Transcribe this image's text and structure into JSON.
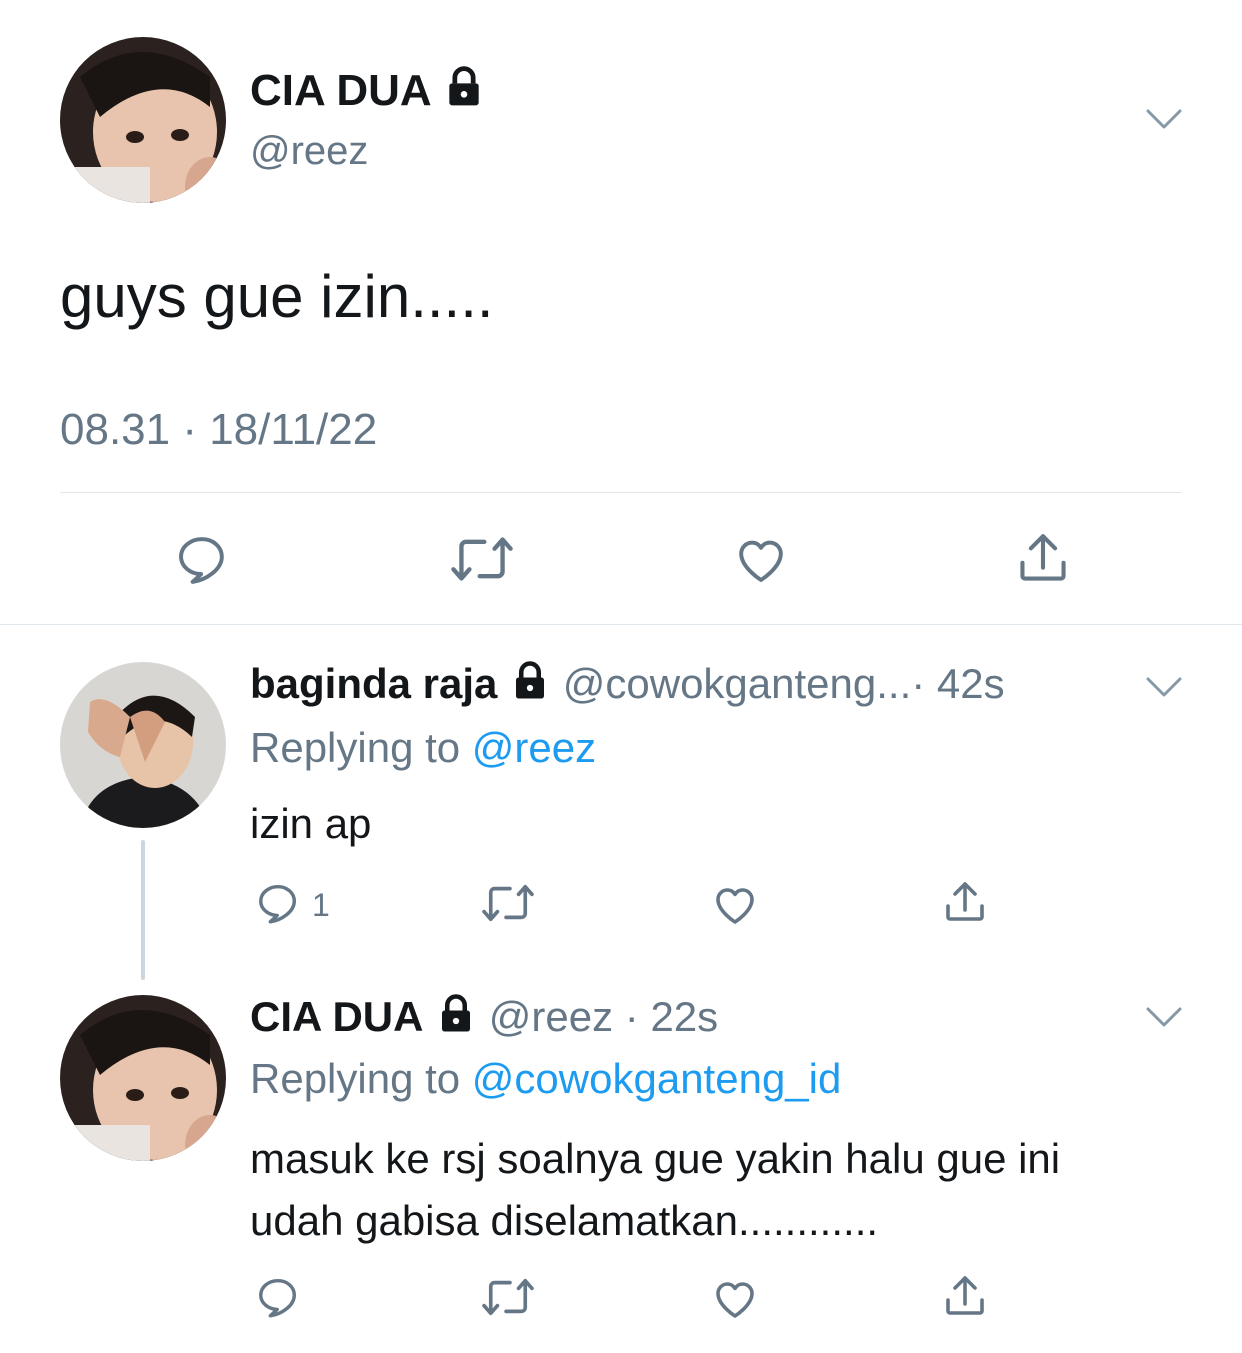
{
  "main_tweet": {
    "author_name": "CIA DUA",
    "author_handle": "@reez",
    "text": "guys gue izin.....",
    "timestamp": "08.31 · 18/11/22"
  },
  "replies": [
    {
      "author_name": "baginda raja",
      "author_handle": "@cowokganteng...",
      "time": "· 42s",
      "replying_prefix": "Replying to",
      "replying_to": "@reez",
      "text": "izin ap",
      "reply_count": "1"
    },
    {
      "author_name": "CIA DUA",
      "author_handle": "@reez",
      "time": "· 22s",
      "replying_prefix": "Replying to",
      "replying_to": "@cowokganteng_id",
      "text_line1": "masuk ke rsj soalnya gue yakin halu gue ini",
      "text_line2": "udah gabisa diselamatkan............"
    }
  ],
  "colors": {
    "accent": "#1d9bf0",
    "muted": "#657786",
    "divider": "#e1e8ed"
  },
  "icons": [
    "lock-icon",
    "chevron-down-icon",
    "reply-icon",
    "retweet-icon",
    "like-icon",
    "share-icon"
  ]
}
